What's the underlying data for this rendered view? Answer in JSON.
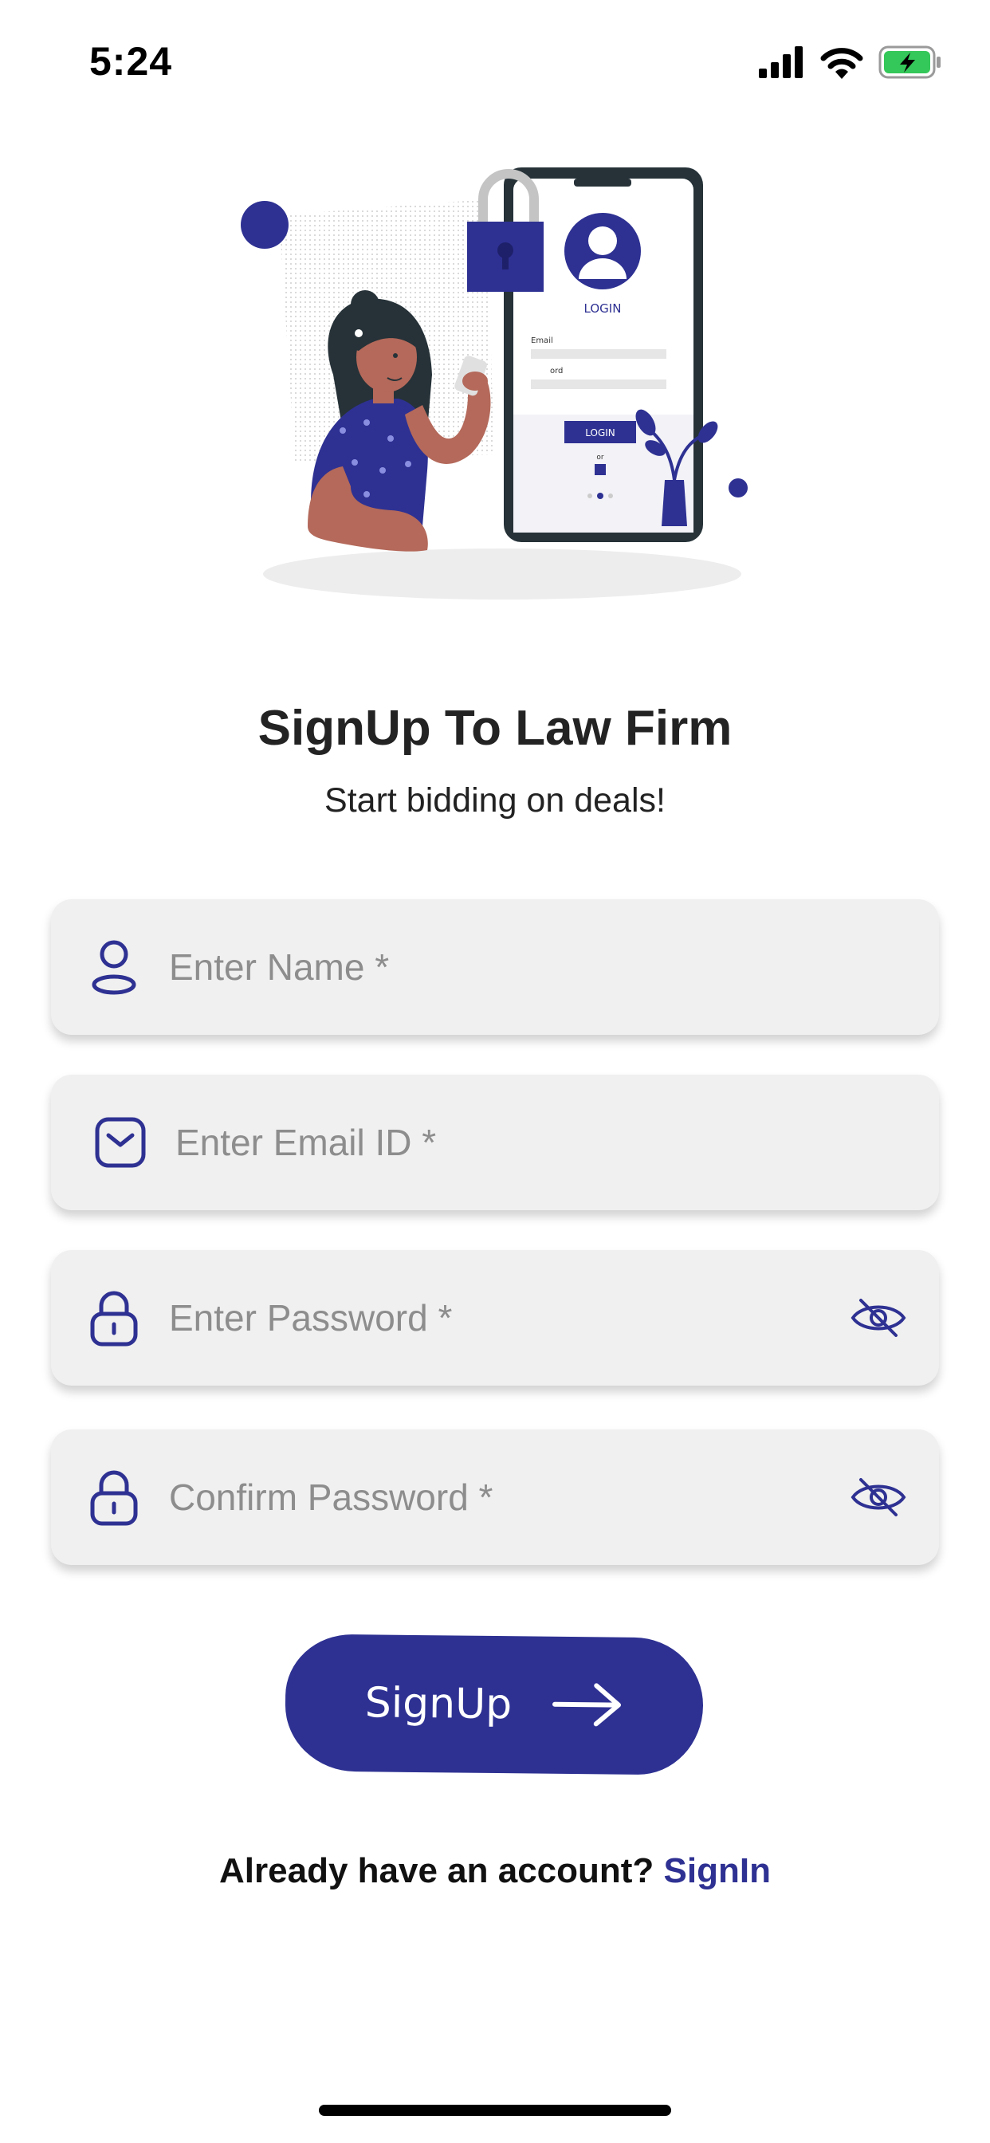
{
  "status_bar": {
    "time": "5:24",
    "icons": [
      "cellular-signal-icon",
      "wifi-icon",
      "battery-charging-icon"
    ],
    "battery_color": "#34c759"
  },
  "illustration": {
    "phone_login_title": "LOGIN",
    "phone_email_label": "Email",
    "phone_password_label": "ord",
    "phone_login_button": "LOGIN",
    "phone_or": "or"
  },
  "header": {
    "title": "SignUp To Law Firm",
    "subtitle": "Start bidding on deals!"
  },
  "form": {
    "name": {
      "placeholder": "Enter Name *",
      "value": "",
      "icon": "user-icon"
    },
    "email": {
      "placeholder": "Enter Email ID *",
      "value": "",
      "icon": "mail-icon"
    },
    "password": {
      "placeholder": "Enter Password *",
      "value": "",
      "icon": "lock-icon",
      "toggle_icon": "eye-off-icon"
    },
    "confirm_password": {
      "placeholder": "Confirm Password *",
      "value": "",
      "icon": "lock-icon",
      "toggle_icon": "eye-off-icon"
    }
  },
  "signup_button": {
    "label": "SignUp",
    "icon": "arrow-right-icon"
  },
  "footer": {
    "prompt": "Already have an account?",
    "link": "SignIn"
  },
  "colors": {
    "accent": "#2e3192",
    "field_bg": "#f0f0f0",
    "placeholder": "#8d8d8d",
    "skin": "#b4695a"
  }
}
